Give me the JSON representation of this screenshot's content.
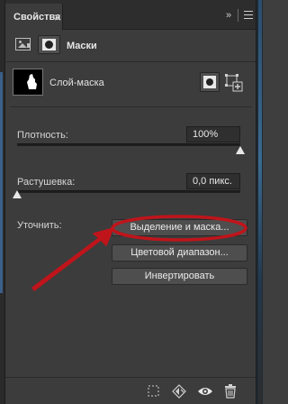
{
  "panel": {
    "tab_title": "Свойства",
    "collapse_glyph": "»"
  },
  "masks": {
    "title": "Маски"
  },
  "layer_mask": {
    "label": "Слой-маска"
  },
  "density": {
    "label": "Плотность:",
    "value": "100%",
    "level_percent": 100
  },
  "feather": {
    "label": "Растушевка:",
    "value": "0,0 пикс.",
    "level_percent": 0
  },
  "refine": {
    "label": "Уточнить:",
    "select_mask_label": "Выделение и маска...",
    "color_range_label": "Цветовой диапазон...",
    "invert_label": "Инвертировать"
  },
  "annotation": {
    "color": "#c0141b"
  },
  "icons": {
    "close": "close-icon",
    "collapse": "collapse-icon",
    "menu": "panel-menu-icon",
    "pixel_mask": "pixel-mask-icon",
    "vector_mask": "vector-mask-icon",
    "load_selection": "load-selection-icon",
    "apply_mask": "apply-mask-icon",
    "visibility": "eye-icon",
    "delete": "trash-icon"
  }
}
